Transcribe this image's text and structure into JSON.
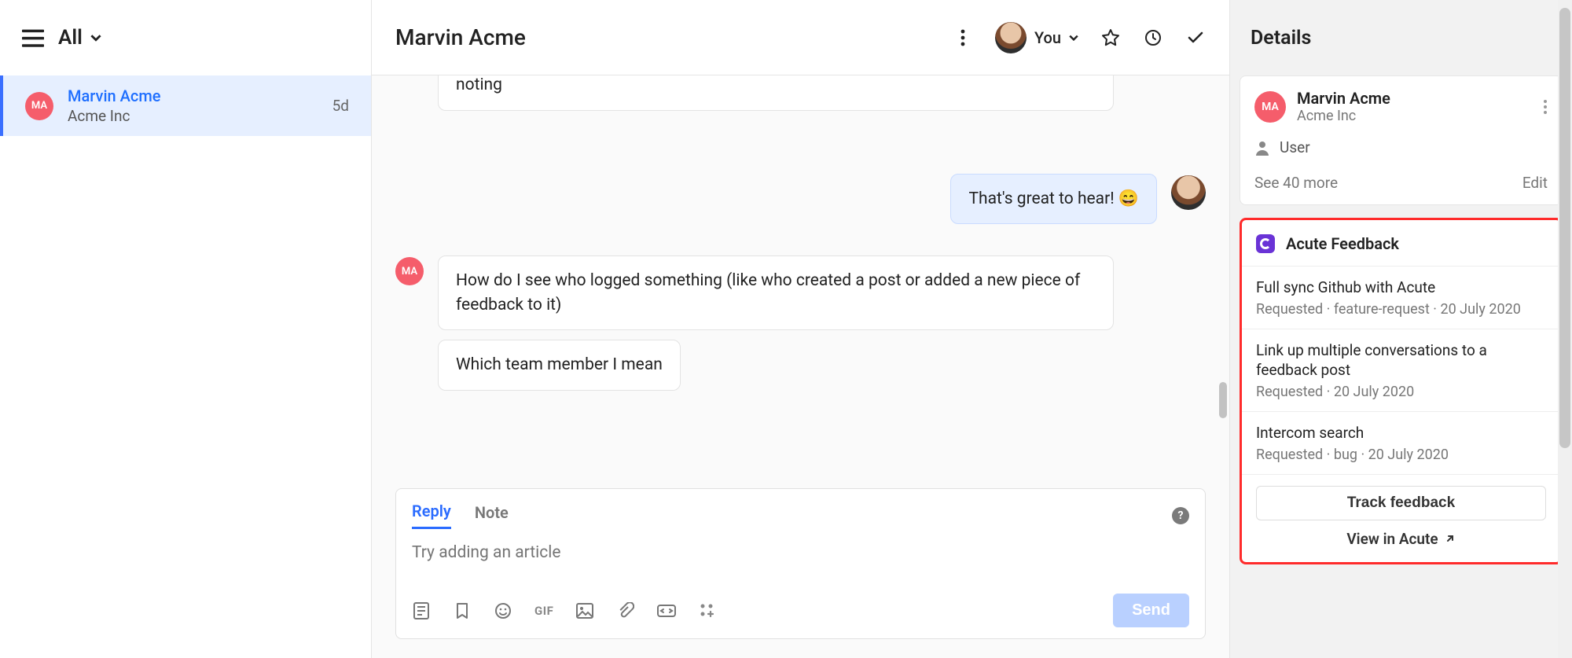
{
  "sidebar": {
    "filter_label": "All",
    "conversations": [
      {
        "initials": "MA",
        "name": "Marvin Acme",
        "company": "Acme Inc",
        "time": "5d"
      }
    ]
  },
  "header": {
    "title": "Marvin Acme",
    "assignee_label": "You"
  },
  "messages": {
    "m0_partial": "it avoids that this little window closes by accident and you lose everything you were noting",
    "m1_out": "That's great to hear! 😄",
    "m2a": "How do I see who logged something (like who created a post or added a new piece of feedback to it)",
    "m2b": "Which team member I mean",
    "customer_initials": "MA"
  },
  "composer": {
    "tab_reply": "Reply",
    "tab_note": "Note",
    "placeholder": "Try adding an article",
    "gif_label": "GIF",
    "send_label": "Send"
  },
  "details": {
    "title": "Details",
    "user": {
      "initials": "MA",
      "name": "Marvin Acme",
      "company": "Acme Inc",
      "type": "User",
      "see_more": "See 40 more",
      "edit": "Edit"
    },
    "acute": {
      "title": "Acute Feedback",
      "items": [
        {
          "title": "Full sync Github with Acute",
          "meta": "Requested · feature-request · 20 July 2020"
        },
        {
          "title": "Link up multiple conversations to a feedback post",
          "meta": "Requested · 20 July 2020"
        },
        {
          "title": "Intercom search",
          "meta": "Requested · bug · 20 July 2020"
        }
      ],
      "track_label": "Track feedback",
      "view_label": "View in Acute"
    }
  }
}
